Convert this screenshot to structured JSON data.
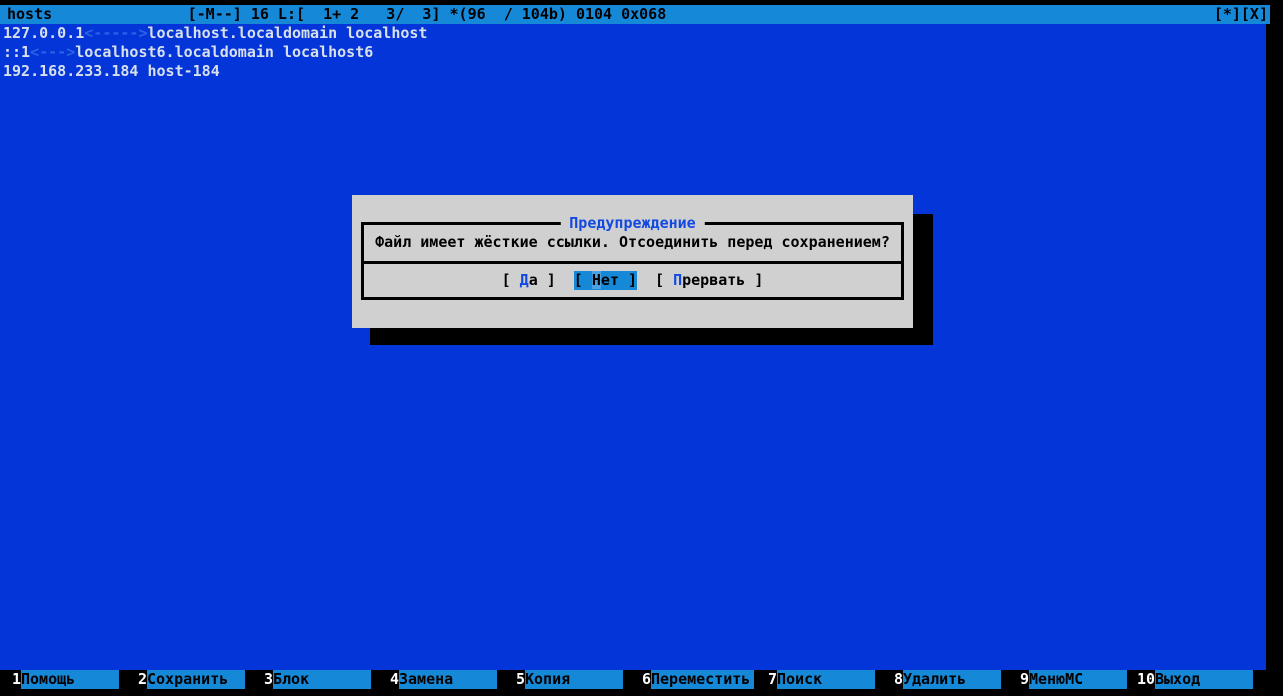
{
  "colors": {
    "background_blue": "#0435d8",
    "bar_azure": "#1688d8",
    "dialog_gray": "#d0d0d0",
    "accent_blue": "#1249e0",
    "editor_text": "#d8e0ee",
    "tab_arrow_blue": "#2c63e6",
    "cursor_blue": "#4aa2e2",
    "shadow_black": "#000000"
  },
  "title_bar": {
    "status": "hosts               [-M--] 16 L:[  1+ 2   3/  3] *(96  / 104b) 0104 0x068",
    "maximize": "[*]",
    "close": "[X]"
  },
  "editor": {
    "lines": [
      {
        "pre": "127.0.0.1",
        "tab": "<----->",
        "post": "localhost.localdomain localhost"
      },
      {
        "pre": "::1",
        "tab": "<--->",
        "post": "localhost6.localdomain localhost6"
      },
      {
        "pre": "192.168.233.184 host-184",
        "tab": "",
        "post": ""
      }
    ]
  },
  "dialog": {
    "title": "Предупреждение",
    "message": "Файл имеет жёсткие ссылки. Отсоединить перед сохранением?",
    "buttons": [
      {
        "open": "[ ",
        "hotkey": "Д",
        "rest": "а",
        "close": " ]",
        "selected": false
      },
      {
        "open": "[ ",
        "hotkey": "Н",
        "rest": "ет",
        "close": " ]",
        "selected": true
      },
      {
        "open": "[ ",
        "hotkey": "П",
        "rest": "рервать",
        "close": " ]",
        "selected": false
      }
    ]
  },
  "function_bar": [
    {
      "key": "1",
      "label": "Помощь"
    },
    {
      "key": "2",
      "label": "Сохранить"
    },
    {
      "key": "3",
      "label": "Блок"
    },
    {
      "key": "4",
      "label": "Замена"
    },
    {
      "key": "5",
      "label": "Копия"
    },
    {
      "key": "6",
      "label": "Переместить"
    },
    {
      "key": "7",
      "label": "Поиск"
    },
    {
      "key": "8",
      "label": "Удалить"
    },
    {
      "key": "9",
      "label": "МенюМС"
    },
    {
      "key": "10",
      "label": "Выход"
    }
  ]
}
